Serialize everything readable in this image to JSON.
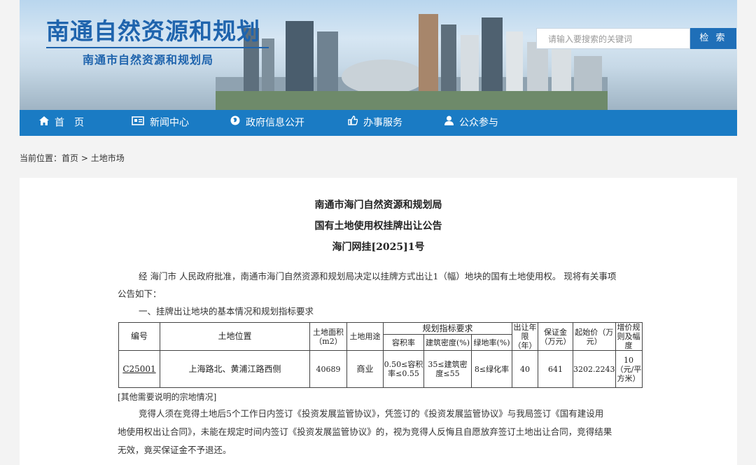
{
  "header": {
    "site_title": "南通自然资源和规划",
    "site_subtitle": "南通市自然资源和规划局",
    "search_placeholder": "请输入要搜索的关键词",
    "search_button": "检 索"
  },
  "nav": {
    "items": [
      {
        "label": "首　页",
        "icon": "home-icon"
      },
      {
        "label": "新闻中心",
        "icon": "newspaper-icon"
      },
      {
        "label": "政府信息公开",
        "icon": "globe-icon"
      },
      {
        "label": "办事服务",
        "icon": "thumbs-up-icon"
      },
      {
        "label": "公众参与",
        "icon": "user-icon"
      }
    ]
  },
  "breadcrumb": {
    "prefix": "当前位置：",
    "home": "首页",
    "sep": ">",
    "current": "土地市场"
  },
  "document": {
    "title1": "南通市海门自然资源和规划局",
    "title2": "国有土地使用权挂牌出让公告",
    "title3": "海门网挂[2025]1号",
    "intro_line1": "经 海门市 人民政府批准，南通市海门自然资源和规划局决定以挂牌方式出让1（幅）地块的国有土地使用权。 现将有关事项",
    "intro_line2": "公告如下：",
    "section1": "一、挂牌出让地块的基本情况和规划指标要求",
    "table": {
      "h_code": "编号",
      "h_location": "土地位置",
      "h_area": "土地面积（m2）",
      "h_use": "土地用途",
      "h_plan": "规划指标要求",
      "h_far": "容积率",
      "h_density": "建筑密度(%)",
      "h_green": "绿地率(%)",
      "h_years": "出让年限（年）",
      "h_deposit": "保证金（万元）",
      "h_start": "起始价（万元）",
      "h_incr": "增价规则及幅度",
      "row": {
        "code": "C25001",
        "location": "上海路北、黄浦江路西侧",
        "area": "40689",
        "use": "商业",
        "far": "0.50≤容积率≤0.55",
        "density": "35≤建筑密度≤55",
        "green": "8≤绿化率",
        "years": "40",
        "deposit": "641",
        "start": "3202.2243",
        "incr": "10（元/平方米）"
      }
    },
    "other_note": "[其他需要说明的宗地情况]",
    "para2_line1": "竞得人须在竞得土地后5个工作日内签订《投资发展监管协议》，凭签订的《投资发展监管协议》与我局签订《国有建设用",
    "para2_line2": "地使用权出让合同》，未能在规定时间内签订《投资发展监管协议》的，视为竞得人反悔且自愿放弃签订土地出让合同，竞得结果",
    "para2_line3": "无效，竟买保证金不予退还。"
  }
}
